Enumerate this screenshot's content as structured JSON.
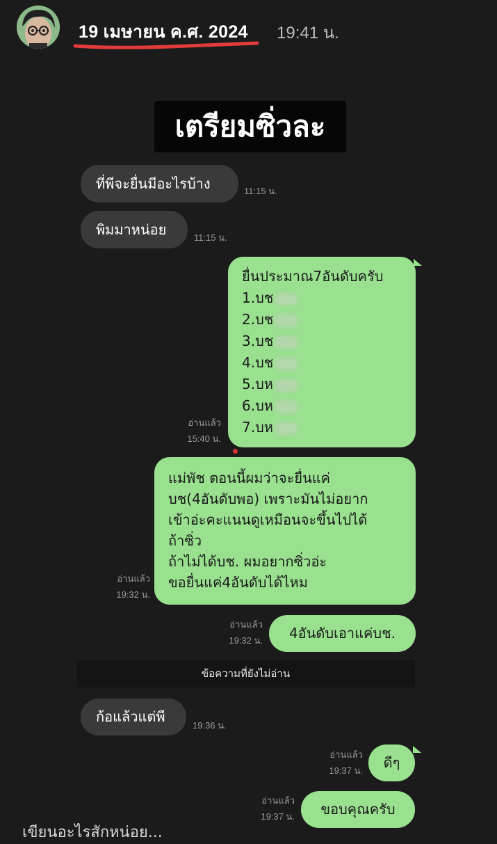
{
  "story": {
    "date": "19 เมษายน ค.ศ. 2024",
    "time": "19:41 น.",
    "title": "เตรียมซิ่วละ",
    "underline_color": "#e23b3b"
  },
  "messages": [
    {
      "id": "m1",
      "side": "in",
      "text": "ที่พีจะยื่นมีอะไรบ้าง",
      "time": "11:15 น."
    },
    {
      "id": "m2",
      "side": "in",
      "text": "พิมมาหน่อย",
      "time": "11:15 น."
    },
    {
      "id": "m3",
      "side": "out",
      "read": "อ่านแล้ว",
      "time": "15:40 น.",
      "lines": [
        "ยื่นประมาณ7อันดับครับ",
        "1.บช",
        "2.บช",
        "3.บช",
        "4.บช",
        "5.บห",
        "6.บห",
        "7.บห"
      ]
    },
    {
      "id": "m4",
      "side": "out",
      "read": "อ่านแล้ว",
      "time": "19:32 น.",
      "lines": [
        "แม่พัช ตอนนี้ผมว่าจะยื่นแค่",
        "บช(4อันดับพอ) เพราะมันไม่อยาก",
        "เข้าอ่ะคะแนนดูเหมือนจะขึ้นไปได้",
        "ถ้าซิ่ว",
        "ถ้าไม่ได้บช. ผมอยากซิ่วอ่ะ",
        "ขอยื่นแค่4อันดับได้ไหม"
      ]
    },
    {
      "id": "m5",
      "side": "out",
      "read": "อ่านแล้ว",
      "time": "19:32 น.",
      "text": "4อันดับเอาแค่บช."
    },
    {
      "id": "m6",
      "side": "in",
      "text": "ก้อแล้วแต่พี",
      "time": "19:36 น."
    },
    {
      "id": "m7",
      "side": "out",
      "read": "อ่านแล้ว",
      "time": "19:37 น.",
      "text": "ดีๆ"
    },
    {
      "id": "m8",
      "side": "out",
      "read": "อ่านแล้ว",
      "time": "19:37 น.",
      "text": "ขอบคุณครับ"
    }
  ],
  "unread_divider": "ข้อความที่ยังไม่อ่าน",
  "compose_placeholder": "เขียนอะไรสักหน่อย...",
  "colors": {
    "outgoing_bubble": "#99e08f",
    "incoming_bubble": "#3a3a3a",
    "background": "#1b1b1b"
  }
}
